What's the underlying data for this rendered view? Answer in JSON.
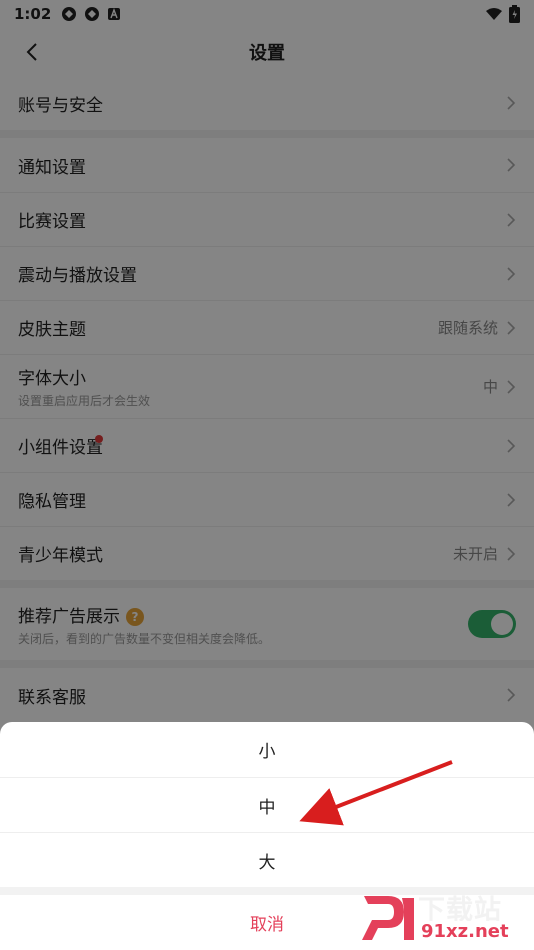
{
  "status_bar": {
    "time": "1:02"
  },
  "header": {
    "title": "设置"
  },
  "settings": {
    "account": {
      "label": "账号与安全"
    },
    "notifications": {
      "label": "通知设置"
    },
    "match": {
      "label": "比赛设置"
    },
    "vibration": {
      "label": "震动与播放设置"
    },
    "theme": {
      "label": "皮肤主题",
      "value": "跟随系统"
    },
    "font_size": {
      "label": "字体大小",
      "subtitle": "设置重启应用后才会生效",
      "value": "中"
    },
    "widget": {
      "label": "小组件设置"
    },
    "privacy": {
      "label": "隐私管理"
    },
    "teen_mode": {
      "label": "青少年模式",
      "value": "未开启"
    },
    "ads": {
      "label": "推荐广告展示",
      "help": "?",
      "subtitle": "关闭后，看到的广告数量不变但相关度会降低。",
      "enabled": true
    },
    "support": {
      "label": "联系客服"
    }
  },
  "font_sheet": {
    "options": [
      "小",
      "中",
      "大"
    ],
    "cancel_label": "取消"
  },
  "watermark": {
    "brand": "下载站",
    "url": "91xz.net"
  },
  "colors": {
    "accent_green": "#34b36a",
    "cancel_red": "#e4405a",
    "arrow_red": "#d81e1e",
    "badge_orange": "#e8a53a"
  }
}
